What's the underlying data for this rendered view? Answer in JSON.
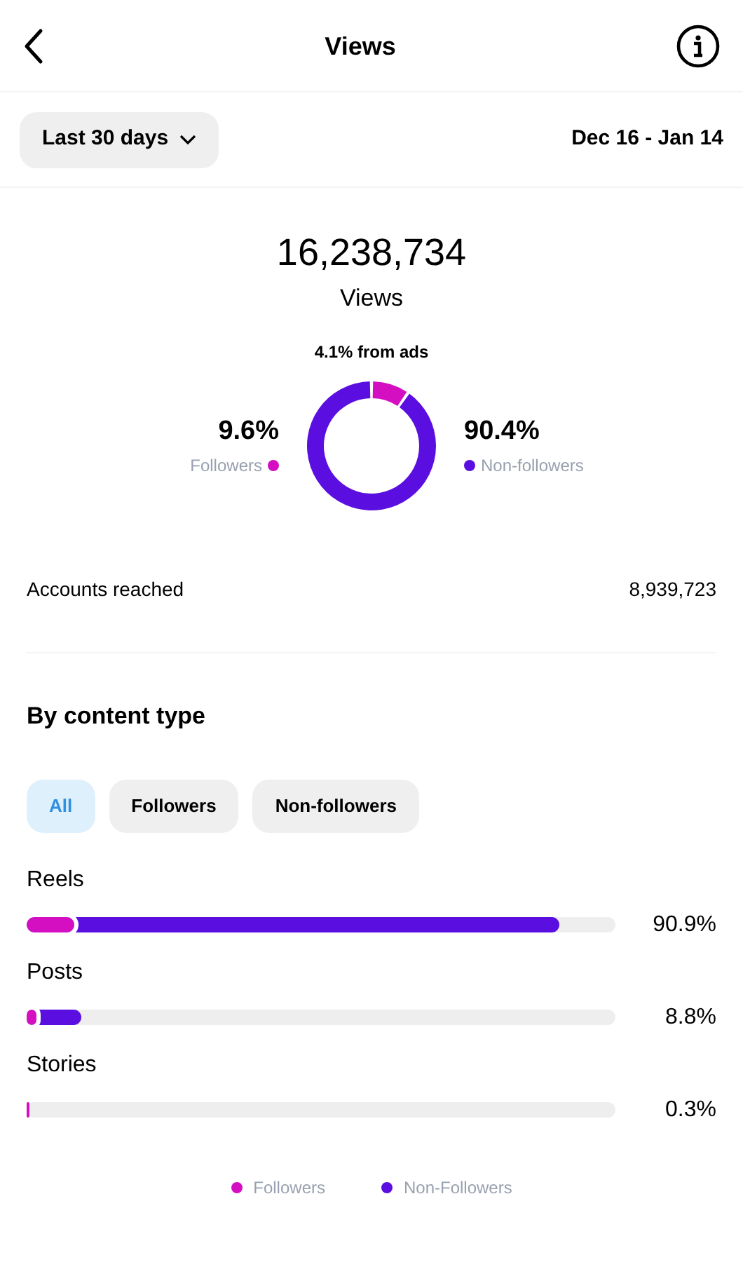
{
  "header": {
    "title": "Views"
  },
  "filter": {
    "range": "Last 30 days",
    "dates": "Dec 16 - Jan 14"
  },
  "summary": {
    "total": "16,238,734",
    "label": "Views",
    "ads_note": "4.1% from ads"
  },
  "audience": {
    "chart_data": {
      "type": "donut",
      "categories": [
        "Followers",
        "Non-followers"
      ],
      "values": [
        9.6,
        90.4
      ],
      "colors": [
        "#d40fc2",
        "#5a0fe0"
      ],
      "value_labels": [
        "9.6%",
        "90.4%"
      ]
    }
  },
  "accounts_reached": {
    "label": "Accounts reached",
    "value": "8,939,723"
  },
  "content_type": {
    "title": "By content type",
    "tabs": [
      {
        "label": "All",
        "selected": true
      },
      {
        "label": "Followers",
        "selected": false
      },
      {
        "label": "Non-followers",
        "selected": false
      }
    ],
    "rows": [
      {
        "name": "Reels",
        "percent": "90.9%",
        "segments": [
          {
            "level": 0.905,
            "color": "#5a0fe0"
          },
          {
            "level": 0.08,
            "color": "#d40fc2"
          }
        ]
      },
      {
        "name": "Posts",
        "percent": "8.8%",
        "segments": [
          {
            "level": 0.092,
            "color": "#5a0fe0"
          },
          {
            "level": 0.016,
            "color": "#d40fc2"
          }
        ]
      },
      {
        "name": "Stories",
        "percent": "0.3%",
        "segments": [
          {
            "level": 0.003,
            "color": "#d40fc2"
          }
        ]
      }
    ],
    "legend": [
      {
        "label": "Followers",
        "color": "#d40fc2"
      },
      {
        "label": "Non-Followers",
        "color": "#5a0fe0"
      }
    ]
  }
}
